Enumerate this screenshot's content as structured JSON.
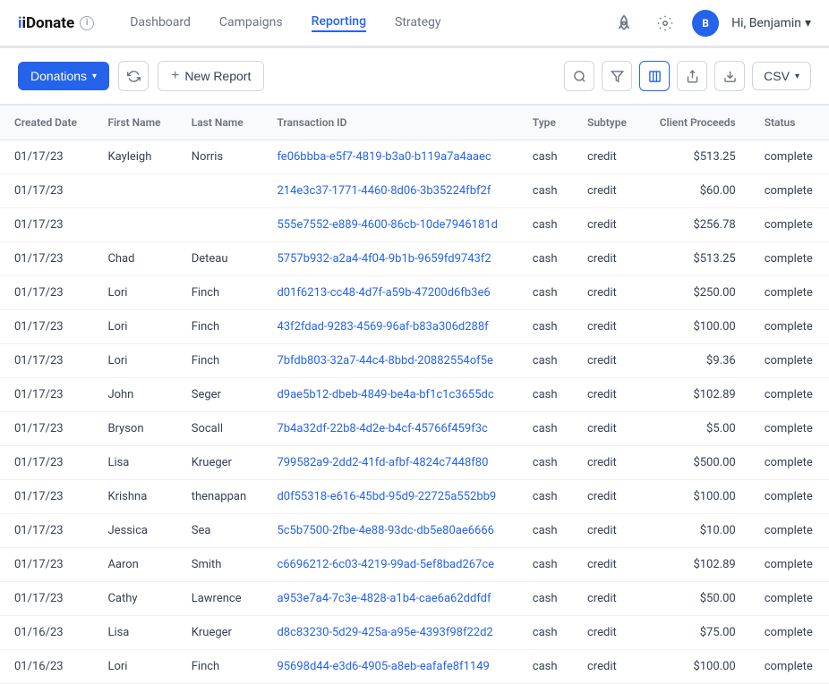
{
  "logo": {
    "text": "iDonate",
    "info_icon": "i"
  },
  "nav": {
    "links": [
      {
        "label": "Dashboard",
        "active": false
      },
      {
        "label": "Campaigns",
        "active": false
      },
      {
        "label": "Reporting",
        "active": true
      },
      {
        "label": "Strategy",
        "active": false
      }
    ],
    "hi_text": "Hi, Benjamin",
    "avatar_initials": "B"
  },
  "toolbar": {
    "donations_label": "Donations",
    "new_report_label": "New Report",
    "csv_label": "CSV"
  },
  "table": {
    "columns": [
      "Created Date",
      "First Name",
      "Last Name",
      "Transaction ID",
      "Type",
      "Subtype",
      "Client Proceeds",
      "Status"
    ],
    "rows": [
      {
        "date": "01/17/23",
        "first": "Kayleigh",
        "last": "Norris",
        "txn": "fe06bbba-e5f7-4819-b3a0-b119a7a4aaec",
        "type": "cash",
        "subtype": "credit",
        "proceeds": "$513.25",
        "status": "complete"
      },
      {
        "date": "01/17/23",
        "first": "",
        "last": "",
        "txn": "214e3c37-1771-4460-8d06-3b35224fbf2f",
        "type": "cash",
        "subtype": "credit",
        "proceeds": "$60.00",
        "status": "complete"
      },
      {
        "date": "01/17/23",
        "first": "",
        "last": "",
        "txn": "555e7552-e889-4600-86cb-10de7946181d",
        "type": "cash",
        "subtype": "credit",
        "proceeds": "$256.78",
        "status": "complete"
      },
      {
        "date": "01/17/23",
        "first": "Chad",
        "last": "Deteau",
        "txn": "5757b932-a2a4-4f04-9b1b-9659fd9743f2",
        "type": "cash",
        "subtype": "credit",
        "proceeds": "$513.25",
        "status": "complete"
      },
      {
        "date": "01/17/23",
        "first": "Lori",
        "last": "Finch",
        "txn": "d01f6213-cc48-4d7f-a59b-47200d6fb3e6",
        "type": "cash",
        "subtype": "credit",
        "proceeds": "$250.00",
        "status": "complete"
      },
      {
        "date": "01/17/23",
        "first": "Lori",
        "last": "Finch",
        "txn": "43f2fdad-9283-4569-96af-b83a306d288f",
        "type": "cash",
        "subtype": "credit",
        "proceeds": "$100.00",
        "status": "complete"
      },
      {
        "date": "01/17/23",
        "first": "Lori",
        "last": "Finch",
        "txn": "7bfdb803-32a7-44c4-8bbd-20882554of5e",
        "type": "cash",
        "subtype": "credit",
        "proceeds": "$9.36",
        "status": "complete"
      },
      {
        "date": "01/17/23",
        "first": "John",
        "last": "Seger",
        "txn": "d9ae5b12-dbeb-4849-be4a-bf1c1c3655dc",
        "type": "cash",
        "subtype": "credit",
        "proceeds": "$102.89",
        "status": "complete"
      },
      {
        "date": "01/17/23",
        "first": "Bryson",
        "last": "Socall",
        "txn": "7b4a32df-22b8-4d2e-b4cf-45766f459f3c",
        "type": "cash",
        "subtype": "credit",
        "proceeds": "$5.00",
        "status": "complete"
      },
      {
        "date": "01/17/23",
        "first": "Lisa",
        "last": "Krueger",
        "txn": "799582a9-2dd2-41fd-afbf-4824c7448f80",
        "type": "cash",
        "subtype": "credit",
        "proceeds": "$500.00",
        "status": "complete"
      },
      {
        "date": "01/17/23",
        "first": "Krishna",
        "last": "thenappan",
        "txn": "d0f55318-e616-45bd-95d9-22725a552bb9",
        "type": "cash",
        "subtype": "credit",
        "proceeds": "$100.00",
        "status": "complete"
      },
      {
        "date": "01/17/23",
        "first": "Jessica",
        "last": "Sea",
        "txn": "5c5b7500-2fbe-4e88-93dc-db5e80ae6666",
        "type": "cash",
        "subtype": "credit",
        "proceeds": "$10.00",
        "status": "complete"
      },
      {
        "date": "01/17/23",
        "first": "Aaron",
        "last": "Smith",
        "txn": "c6696212-6c03-4219-99ad-5ef8bad267ce",
        "type": "cash",
        "subtype": "credit",
        "proceeds": "$102.89",
        "status": "complete"
      },
      {
        "date": "01/17/23",
        "first": "Cathy",
        "last": "Lawrence",
        "txn": "a953e7a4-7c3e-4828-a1b4-cae6a62ddfdf",
        "type": "cash",
        "subtype": "credit",
        "proceeds": "$50.00",
        "status": "complete"
      },
      {
        "date": "01/16/23",
        "first": "Lisa",
        "last": "Krueger",
        "txn": "d8c83230-5d29-425a-a95e-4393f98f22d2",
        "type": "cash",
        "subtype": "credit",
        "proceeds": "$75.00",
        "status": "complete"
      },
      {
        "date": "01/16/23",
        "first": "Lori",
        "last": "Finch",
        "txn": "95698d44-e3d6-4905-a8eb-eafafe8f1149",
        "type": "cash",
        "subtype": "credit",
        "proceeds": "$100.00",
        "status": "complete"
      }
    ]
  }
}
